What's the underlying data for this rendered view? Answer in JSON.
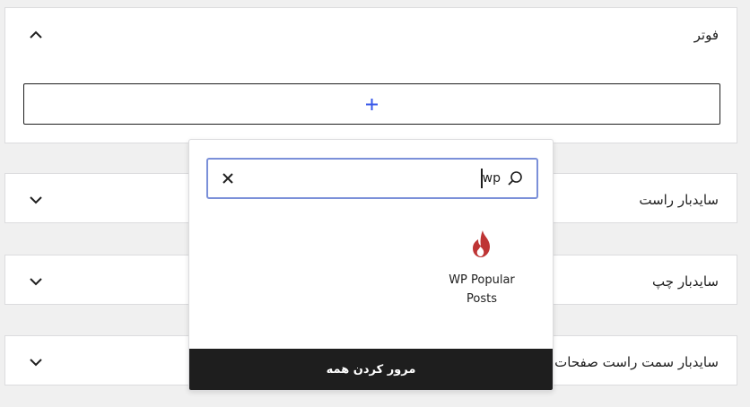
{
  "panels": [
    {
      "title": "فوتر",
      "expanded": true,
      "chevron": "chevron-up-icon"
    },
    {
      "title": "سایدبار راست",
      "expanded": false,
      "chevron": "chevron-down-icon"
    },
    {
      "title": "سایدبار چپ",
      "expanded": false,
      "chevron": "chevron-down-icon"
    },
    {
      "title": "سایدبار سمت راست صفحات و",
      "expanded": false,
      "chevron": "chevron-down-icon"
    }
  ],
  "add_block": {
    "icon": "plus-icon",
    "accent": "#3858e9"
  },
  "inserter": {
    "search": {
      "value": "wp",
      "clear_icon": "close-icon",
      "search_icon": "search-icon",
      "border_color": "#7b90d9"
    },
    "results": [
      {
        "label": "WP Popular Posts",
        "icon": "flame-icon",
        "color": "#be3434"
      }
    ],
    "browse_all": "مرور کردن همه"
  }
}
